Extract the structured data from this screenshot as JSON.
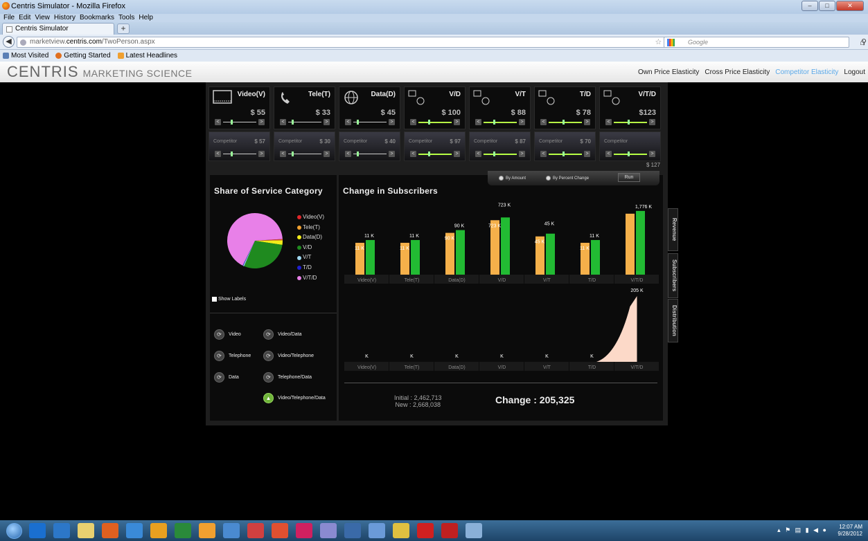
{
  "browser": {
    "window_title": "Centris Simulator - Mozilla Firefox",
    "menu": [
      "File",
      "Edit",
      "View",
      "History",
      "Bookmarks",
      "Tools",
      "Help"
    ],
    "tab_title": "Centris Simulator",
    "new_tab": "+",
    "url_host": "marketview.",
    "url_domain": "centris.com",
    "url_path": "/TwoPerson.aspx",
    "search_placeholder": "Google",
    "bookmarks": [
      "Most Visited",
      "Getting Started",
      "Latest Headlines"
    ]
  },
  "app": {
    "logo": "CENTRIS",
    "logo_sub": "MARKETING SCIENCE",
    "nav": [
      "Own Price Elasticity",
      "Cross Price Elasticity",
      "Competitor Elasticity",
      "Logout"
    ],
    "active_nav": "Competitor Elasticity"
  },
  "services": [
    {
      "name": "Video(V)",
      "price": "$ 55",
      "competitor_label": "Competitor",
      "competitor_price": "$ 57",
      "own_level": 0.25,
      "comp_level": 0.25
    },
    {
      "name": "Tele(T)",
      "price": "$ 33",
      "competitor_label": "Competitor",
      "competitor_price": "$ 30",
      "own_level": 0.1,
      "comp_level": 0.1
    },
    {
      "name": "Data(D)",
      "price": "$ 45",
      "competitor_label": "Competitor",
      "competitor_price": "$ 40",
      "own_level": 0.1,
      "comp_level": 0.1
    },
    {
      "name": "V/D",
      "price": "$ 100",
      "competitor_label": "Competitor",
      "competitor_price": "$ 97",
      "own_level": 0.3,
      "comp_level": 0.3
    },
    {
      "name": "V/T",
      "price": "$ 88",
      "competitor_label": "Competitor",
      "competitor_price": "$ 87",
      "own_level": 0.3,
      "comp_level": 0.3
    },
    {
      "name": "T/D",
      "price": "$ 78",
      "competitor_label": "Competitor",
      "competitor_price": "$ 70",
      "own_level": 0.45,
      "comp_level": 0.45
    },
    {
      "name": "V/T/D",
      "price": "$123",
      "competitor_label": "Competitor",
      "competitor_price": "$ 127",
      "own_level": 0.45,
      "comp_level": 0.45
    }
  ],
  "share_panel": {
    "title": "Share of Service Category",
    "show_labels": "Show Labels",
    "legend": [
      {
        "label": "Video(V)",
        "color": "#e0262a"
      },
      {
        "label": "Tele(T)",
        "color": "#f0a030"
      },
      {
        "label": "Data(D)",
        "color": "#f2ec1a"
      },
      {
        "label": "V/D",
        "color": "#1f8a1f"
      },
      {
        "label": "V/T",
        "color": "#a0d8f0"
      },
      {
        "label": "T/D",
        "color": "#2020d0"
      },
      {
        "label": "V/T/D",
        "color": "#e880e8"
      }
    ],
    "buttons": [
      {
        "label": "Video",
        "active": false
      },
      {
        "label": "Video/Data",
        "active": false
      },
      {
        "label": "Telephone",
        "active": false
      },
      {
        "label": "Video/Telephone",
        "active": false
      },
      {
        "label": "Data",
        "active": false
      },
      {
        "label": "Telephone/Data",
        "active": false
      },
      {
        "label": "Video/Telephone/Data",
        "active": true
      }
    ]
  },
  "change_panel": {
    "title": "Change in Subscribers",
    "option_amount": "By Amount",
    "option_percent": "By Percent Change",
    "run": "Run",
    "side_tabs": [
      "Revenue",
      "Subscribers",
      "Distribution"
    ],
    "initial": "Initial : 2,462,713",
    "new": "New : 2,668,038",
    "change": "Change : 205,325"
  },
  "chart_data": [
    {
      "type": "pie",
      "title": "Share of Service Category",
      "categories": [
        "Video(V)",
        "Tele(T)",
        "Data(D)",
        "V/D",
        "V/T",
        "T/D",
        "V/T/D"
      ],
      "values": [
        0.4,
        0.5,
        2.5,
        29,
        0.6,
        0.3,
        66.7
      ],
      "colors": [
        "#e0262a",
        "#f0a030",
        "#f2ec1a",
        "#1f8a1f",
        "#a0d8f0",
        "#2020d0",
        "#e880e8"
      ]
    },
    {
      "type": "bar",
      "title": "Change in Subscribers",
      "categories": [
        "Video(V)",
        "Tele(T)",
        "Data(D)",
        "V/D",
        "V/T",
        "T/D",
        "V/T/D"
      ],
      "series": [
        {
          "values": [
            11,
            11,
            90,
            723,
            45,
            11,
            1776
          ],
          "color": "#f5b04a"
        },
        {
          "values": [
            11,
            11,
            90,
            723,
            45,
            11,
            1776
          ],
          "color": "#22bb33"
        }
      ],
      "labels_left": [
        "11 K",
        "11 K",
        "90 K",
        "723 K",
        "45 K",
        "11 K",
        ""
      ],
      "labels_right": [
        "11 K",
        "11 K",
        "90 K",
        "723 K",
        "45 K",
        "11 K",
        "1,776 K"
      ]
    },
    {
      "type": "area",
      "categories": [
        "Video(V)",
        "Tele(T)",
        "Data(D)",
        "V/D",
        "V/T",
        "T/D",
        "V/T/D"
      ],
      "values": [
        0,
        0,
        0,
        0,
        0,
        0,
        205
      ],
      "labels": [
        "K",
        "K",
        "K",
        "K",
        "K",
        "K",
        "205 K"
      ],
      "color": "#fcd9c8"
    }
  ],
  "taskbar": {
    "time": "12:07 AM",
    "date": "9/28/2012"
  }
}
